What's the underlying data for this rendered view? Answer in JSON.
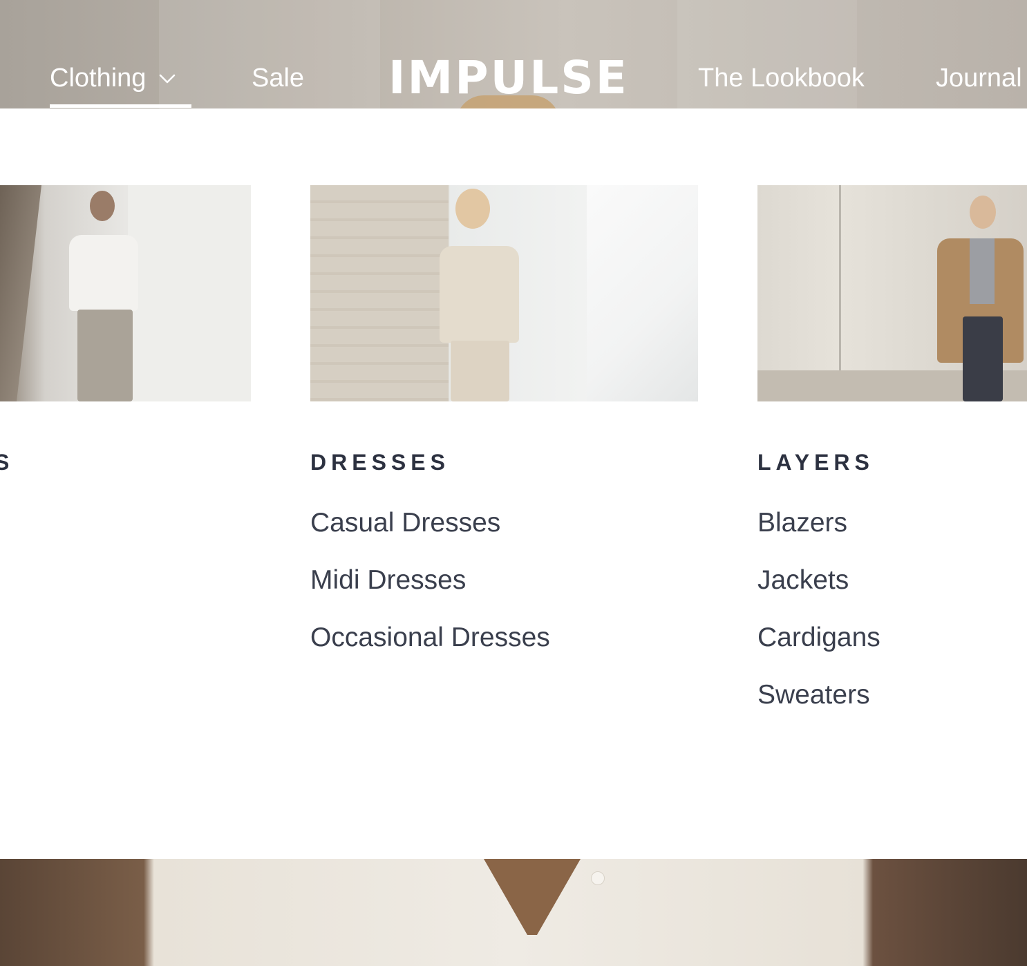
{
  "nav": {
    "clothing_label": "Clothing",
    "sale_label": "Sale",
    "logo": "IMPULSE",
    "lookbook_label": "The Lookbook",
    "journal_label": "Journal"
  },
  "menu": {
    "columns": [
      {
        "title": "S",
        "links": []
      },
      {
        "title": "DRESSES",
        "links": [
          "Casual Dresses",
          "Midi Dresses",
          "Occasional Dresses"
        ]
      },
      {
        "title": "LAYERS",
        "links": [
          "Blazers",
          "Jackets",
          "Cardigans",
          "Sweaters"
        ]
      }
    ]
  },
  "icons": {
    "chevron": "chevron-down-icon"
  },
  "colors": {
    "nav_text": "#ffffff",
    "menu_title": "#2c3140",
    "menu_link": "#3a3f4d"
  }
}
